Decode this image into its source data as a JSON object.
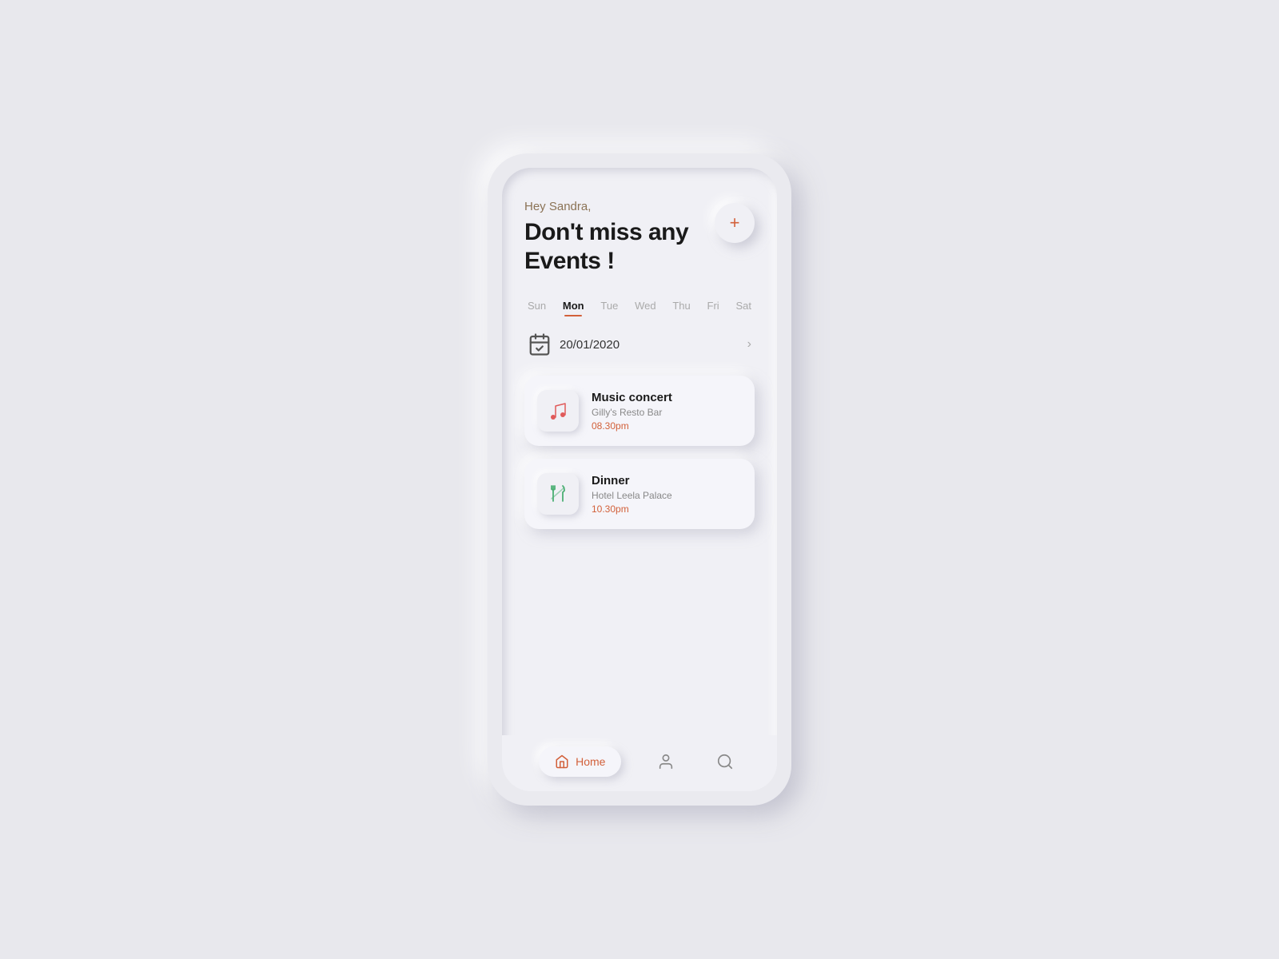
{
  "header": {
    "greeting": "Hey Sandra,",
    "headline_line1": "Don't miss any",
    "headline_line2": "Events !",
    "add_button_label": "+"
  },
  "days": [
    {
      "label": "Sun",
      "active": false
    },
    {
      "label": "Mon",
      "active": true
    },
    {
      "label": "Tue",
      "active": false
    },
    {
      "label": "Wed",
      "active": false
    },
    {
      "label": "Thu",
      "active": false
    },
    {
      "label": "Fri",
      "active": false
    },
    {
      "label": "Sat",
      "active": false
    }
  ],
  "date": {
    "text": "20/01/2020"
  },
  "events": [
    {
      "title": "Music concert",
      "location": "Gilly's Resto Bar",
      "time": "08.30pm",
      "icon": "🎵",
      "icon_color": "#e05a5a"
    },
    {
      "title": "Dinner",
      "location": "Hotel Leela Palace",
      "time": "10.30pm",
      "icon": "🍴",
      "icon_color": "#4caf74"
    }
  ],
  "nav": {
    "home_label": "Home",
    "home_icon": "🏠",
    "profile_icon": "👤",
    "search_icon": "🔍"
  },
  "colors": {
    "accent": "#d2603a",
    "music_icon": "#e05a5a",
    "dinner_icon": "#4caf74"
  }
}
